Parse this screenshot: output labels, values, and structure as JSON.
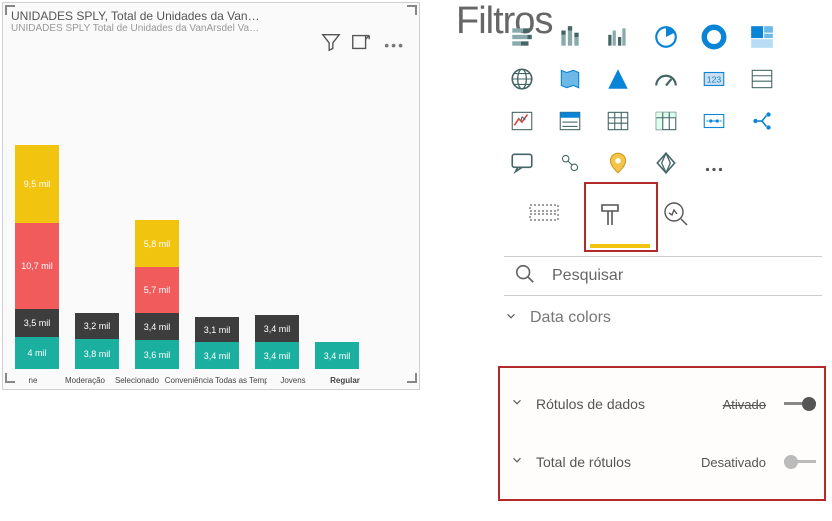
{
  "pane_title": "Filtros",
  "chart": {
    "title": "UNIDADES SPLY, Total de Unidades da Van…",
    "subtitle": "UNIDADES SPLY Total de Unidades da VanArsdel  Va…",
    "categories": [
      "ne",
      "Moderação",
      "Selecionado",
      "Conveniência",
      "Todas as Temporadas",
      "Jovens",
      "Regular"
    ],
    "segments": [
      {
        "cat": 0,
        "stack": [
          {
            "color": "teal",
            "label": "4 mil",
            "h": 32
          },
          {
            "color": "dark",
            "label": "3,5 mil",
            "h": 28
          },
          {
            "color": "red",
            "label": "10,7 mil",
            "h": 86
          },
          {
            "color": "yellow",
            "label": "9,5 mil",
            "h": 78
          }
        ]
      },
      {
        "cat": 1,
        "stack": [
          {
            "color": "teal",
            "label": "3,8 mil",
            "h": 30
          },
          {
            "color": "dark",
            "label": "3,2 mil",
            "h": 26
          }
        ]
      },
      {
        "cat": 2,
        "stack": [
          {
            "color": "teal",
            "label": "3,6 mil",
            "h": 29
          },
          {
            "color": "dark",
            "label": "3,4 mil",
            "h": 27
          },
          {
            "color": "red",
            "label": "5,7 mil",
            "h": 46
          },
          {
            "color": "yellow",
            "label": "5,8 mil",
            "h": 47
          }
        ]
      },
      {
        "cat": 3,
        "stack": [
          {
            "color": "teal",
            "label": "3,4 mil",
            "h": 27
          },
          {
            "color": "dark",
            "label": "3,1 mil",
            "h": 25
          }
        ]
      },
      {
        "cat": 4,
        "stack": [
          {
            "color": "teal",
            "label": "3,4 mil",
            "h": 27
          },
          {
            "color": "dark",
            "label": "3,4 mil",
            "h": 27
          }
        ]
      },
      {
        "cat": 5,
        "stack": [
          {
            "color": "teal",
            "label": "3,4 mil",
            "h": 27
          }
        ]
      },
      {
        "cat": 6,
        "stack": []
      }
    ]
  },
  "chart_data": {
    "type": "bar",
    "stacked": true,
    "title": "UNIDADES SPLY, Total de Unidades da VanArsdel",
    "categories": [
      "ne",
      "Moderação",
      "Selecionado",
      "Conveniência",
      "Todas as Temporadas",
      "Jovens",
      "Regular"
    ],
    "series": [
      {
        "name": "Teal",
        "values": [
          4000,
          3800,
          3600,
          3400,
          3400,
          3400,
          null
        ]
      },
      {
        "name": "Dark",
        "values": [
          3500,
          3200,
          3400,
          3100,
          3400,
          null,
          null
        ]
      },
      {
        "name": "Red",
        "values": [
          10700,
          null,
          5700,
          null,
          null,
          null,
          null
        ]
      },
      {
        "name": "Yellow",
        "values": [
          9500,
          null,
          5800,
          null,
          null,
          null,
          null
        ]
      }
    ],
    "ylabel": "",
    "xlabel": ""
  },
  "search_placeholder": "Pesquisar",
  "data_colors_label": "Data colors",
  "sections": [
    {
      "label": "Rótulos de dados",
      "status": "Ativado",
      "on": true
    },
    {
      "label": "Total de rótulos",
      "status": "Desativado",
      "on": false
    }
  ]
}
